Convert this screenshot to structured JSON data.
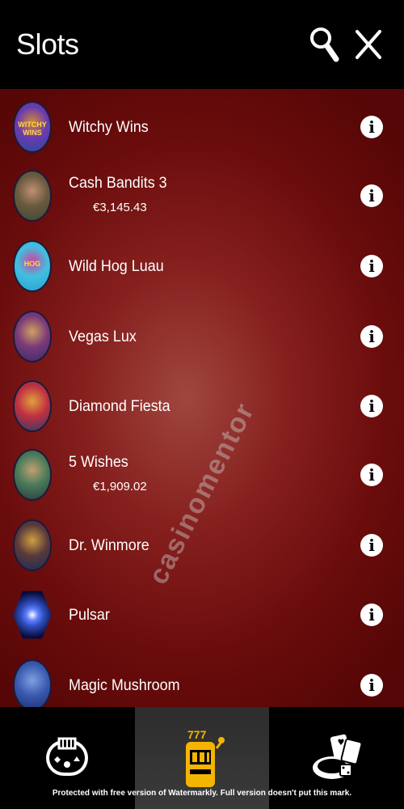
{
  "header": {
    "title": "Slots",
    "search_icon": "search-icon",
    "close_icon": "close-icon"
  },
  "games": [
    {
      "name": "Witchy Wins",
      "jackpot": null,
      "thumb_colors": [
        "#2a4a9a",
        "#6a3ab0",
        "#d08a30"
      ],
      "thumb_text": "WITCHY WINS"
    },
    {
      "name": "Cash Bandits 3",
      "jackpot": "€3,145.43",
      "thumb_colors": [
        "#3a4a30",
        "#6a5a40",
        "#c09070"
      ],
      "thumb_text": ""
    },
    {
      "name": "Wild Hog Luau",
      "jackpot": null,
      "thumb_colors": [
        "#2aa0d0",
        "#40c0e0",
        "#d040a0"
      ],
      "thumb_text": "HOG"
    },
    {
      "name": "Vegas Lux",
      "jackpot": null,
      "thumb_colors": [
        "#3a2a6a",
        "#7a3a7a",
        "#d0a060"
      ],
      "thumb_text": ""
    },
    {
      "name": "Diamond Fiesta",
      "jackpot": null,
      "thumb_colors": [
        "#2a3a6a",
        "#c03040",
        "#e0a040"
      ],
      "thumb_text": ""
    },
    {
      "name": "5 Wishes",
      "jackpot": "€1,909.02",
      "thumb_colors": [
        "#2a3a3a",
        "#4a7a5a",
        "#c0a070"
      ],
      "thumb_text": ""
    },
    {
      "name": "Dr. Winmore",
      "jackpot": null,
      "thumb_colors": [
        "#1a2a5a",
        "#5a3a3a",
        "#d0a040"
      ],
      "thumb_text": ""
    },
    {
      "name": "Pulsar",
      "jackpot": null,
      "thumb_colors": [
        "#0a0a3a",
        "#3050c0",
        "#ffffff"
      ],
      "thumb_text": ""
    },
    {
      "name": "Magic Mushroom",
      "jackpot": null,
      "thumb_colors": [
        "#1a2a6a",
        "#3a5ab0",
        "#80a0e0"
      ],
      "thumb_text": ""
    }
  ],
  "info_glyph": "i",
  "watermark": "casinomentor",
  "bottom_nav": [
    {
      "icon": "live-casino-icon",
      "active": false
    },
    {
      "icon": "slot-machine-icon",
      "active": true
    },
    {
      "icon": "table-games-icon",
      "active": false
    }
  ],
  "notice": "Protected with free version of Watermarkly. Full version doesn't put this mark.",
  "colors": {
    "accent_gold": "#f5b400",
    "background_dark": "#000000",
    "list_red": "#7a1414"
  }
}
